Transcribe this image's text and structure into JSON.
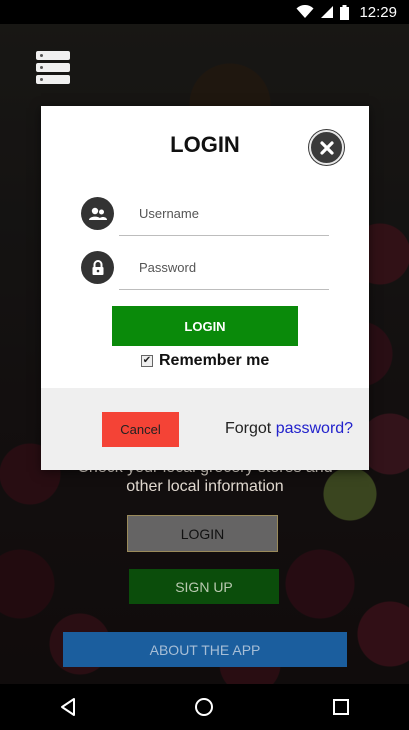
{
  "status_bar": {
    "time": "12:29"
  },
  "background": {
    "tagline_line1": "Check your local grocery stores and",
    "tagline_line2": "other local information",
    "login_label": "LOGIN",
    "signup_label": "SIGN UP",
    "about_label": "ABOUT THE APP"
  },
  "modal": {
    "title": "LOGIN",
    "username_placeholder": "Username",
    "password_placeholder": "Password",
    "login_label": "LOGIN",
    "remember_label": "Remember me",
    "remember_checked": true,
    "cancel_label": "Cancel",
    "forgot_prefix": "Forgot",
    "forgot_link": "password?"
  },
  "colors": {
    "login_green": "#0a8a0a",
    "cancel_red": "#f44336",
    "link_blue": "#2222cc",
    "signup_green": "#0b4d0b",
    "about_blue": "#1b5e9e"
  },
  "icons": {
    "menu": "server-stack-icon",
    "close": "close-icon",
    "username": "users-icon",
    "password": "lock-icon",
    "wifi": "wifi-icon",
    "signal": "cell-signal-icon",
    "battery": "battery-icon",
    "back": "back-triangle-icon",
    "home": "home-circle-icon",
    "recents": "recents-square-icon"
  }
}
